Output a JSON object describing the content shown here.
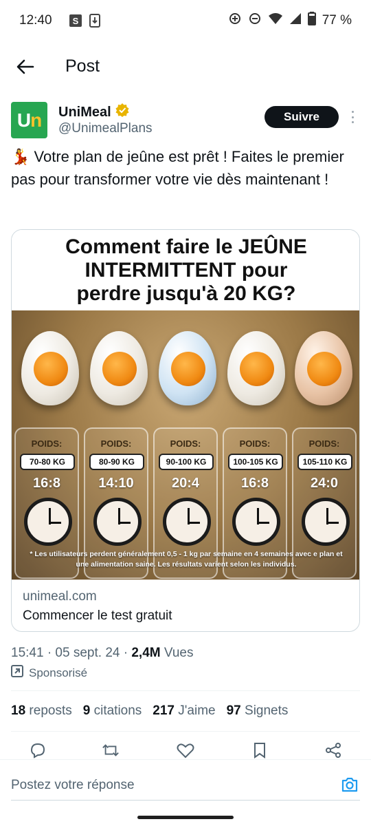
{
  "status_bar": {
    "time": "12:40",
    "battery": "77 %",
    "left_icons": [
      "s-badge-icon",
      "download-icon"
    ],
    "right_icons": [
      "data-saver-icon",
      "do-not-disturb-icon",
      "wifi-icon",
      "signal-icon",
      "battery-icon"
    ]
  },
  "header": {
    "title": "Post"
  },
  "author": {
    "name": "UniMeal",
    "handle": "@UnimealPlans",
    "avatar_text": "Un",
    "avatar_color": "#27a651",
    "verified_color": "#e8b400",
    "follow_label": "Suivre"
  },
  "post": {
    "emoji": "💃",
    "text": " Votre plan de jeûne est prêt ! Faites le premier pas pour transformer votre vie dès maintenant !"
  },
  "card": {
    "headline_line1": "Comment faire le JEÛNE",
    "headline_line2": "INTERMITTENT pour",
    "headline_line3": "perdre jusqu'à 20 KG?",
    "panels": [
      {
        "poids": "POIDS:",
        "range": "70-80 KG",
        "ratio": "16:8"
      },
      {
        "poids": "POIDS:",
        "range": "80-90 KG",
        "ratio": "14:10"
      },
      {
        "poids": "POIDS:",
        "range": "90-100 KG",
        "ratio": "20:4"
      },
      {
        "poids": "POIDS:",
        "range": "100-105 KG",
        "ratio": "16:8"
      },
      {
        "poids": "POIDS:",
        "range": "105-110 KG",
        "ratio": "24:0"
      }
    ],
    "disclaimer": "* Les utilisateurs perdent généralement 0,5 - 1 kg par semaine en 4 semaines avec e plan et une alimentation saine. Les résultats varient selon les individus.",
    "domain": "unimeal.com",
    "cta": "Commencer le test gratuit"
  },
  "meta": {
    "timestamp": "15:41 · 05 sept. 24 · ",
    "views_count": "2,4M",
    "views_label": " Vues",
    "sponsored": "Sponsorisé"
  },
  "stats": {
    "reposts_count": "18",
    "reposts_label": "reposts",
    "quotes_count": "9",
    "quotes_label": "citations",
    "likes_count": "217",
    "likes_label": "J'aime",
    "bookmarks_count": "97",
    "bookmarks_label": "Signets"
  },
  "reply": {
    "placeholder": "Postez votre réponse"
  },
  "colors": {
    "accent": "#1d9bf0",
    "text": "#0f1419",
    "muted": "#536471"
  }
}
